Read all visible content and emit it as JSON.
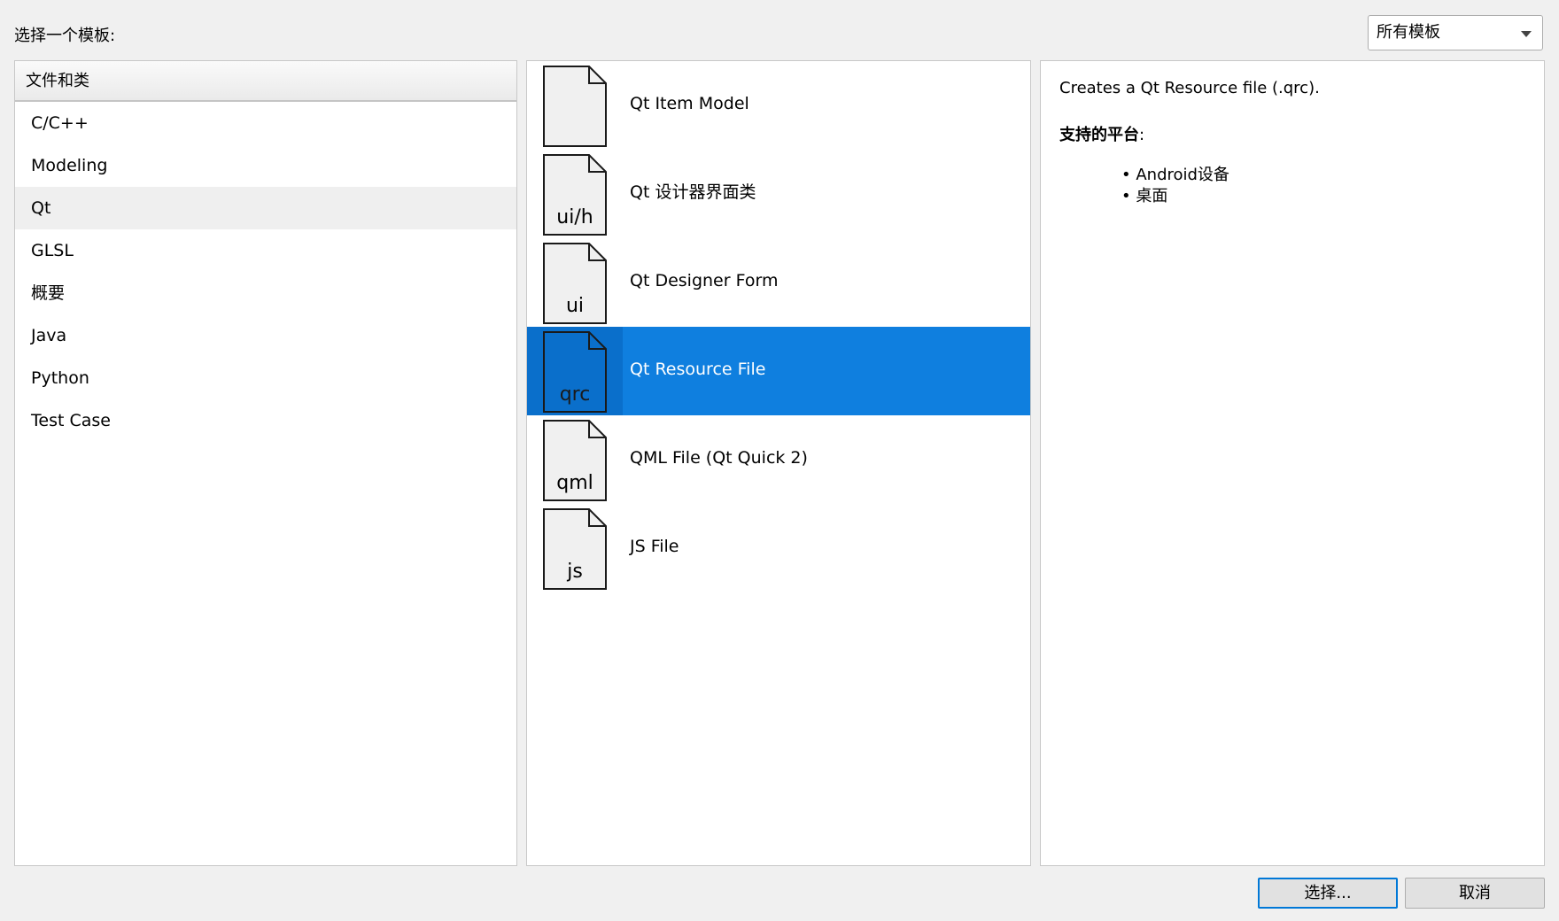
{
  "dialog": {
    "prompt_label": "选择一个模板:",
    "filter_select": {
      "value": "所有模板"
    }
  },
  "categories": {
    "header": "文件和类",
    "items": [
      {
        "label": "C/C++"
      },
      {
        "label": "Modeling"
      },
      {
        "label": "Qt",
        "active": true
      },
      {
        "label": "GLSL"
      },
      {
        "label": "概要"
      },
      {
        "label": "Java"
      },
      {
        "label": "Python"
      },
      {
        "label": "Test Case"
      }
    ]
  },
  "templates": [
    {
      "label": "Qt Item Model",
      "ext": ""
    },
    {
      "label": "Qt 设计器界面类",
      "ext": "ui/h"
    },
    {
      "label": "Qt Designer Form",
      "ext": "ui"
    },
    {
      "label": "Qt Resource File",
      "ext": "qrc",
      "selected": true
    },
    {
      "label": "QML File (Qt Quick 2)",
      "ext": "qml"
    },
    {
      "label": "JS File",
      "ext": "js"
    }
  ],
  "description": {
    "text": "Creates a Qt Resource file (.qrc).",
    "platforms_label": "支持的平台",
    "platforms_colon": ":",
    "platforms": [
      "Android设备",
      "桌面"
    ]
  },
  "buttons": {
    "choose": "选择...",
    "cancel": "取消"
  },
  "colors": {
    "selection": "#0f7fdf",
    "selection_icon": "#0a6fcb",
    "focus_border": "#0078d7"
  }
}
